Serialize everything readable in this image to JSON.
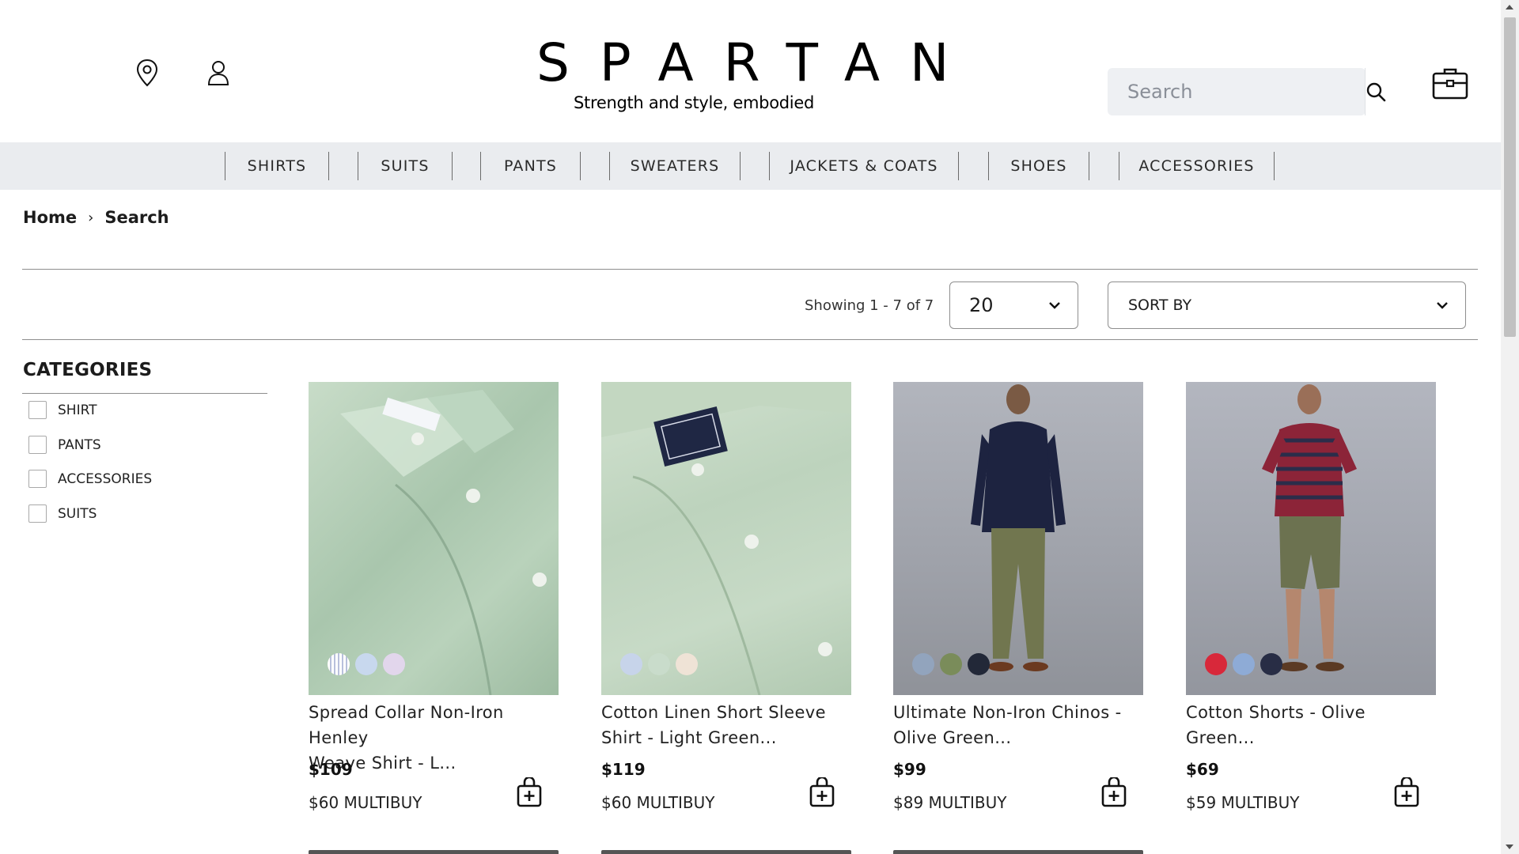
{
  "header": {
    "brand_name": "SPARTAN",
    "tagline": "Strength and style, embodied",
    "search_placeholder": "Search"
  },
  "nav": {
    "items": [
      "SHIRTS",
      "SUITS",
      "PANTS",
      "SWEATERS",
      "JACKETS & COATS",
      "SHOES",
      "ACCESSORIES"
    ]
  },
  "breadcrumb": {
    "home": "Home",
    "separator": "›",
    "current": "Search"
  },
  "toolbar": {
    "showing": "Showing 1 - 7 of 7",
    "per_page": "20",
    "sort_label": "SORT BY"
  },
  "sidebar": {
    "title": "CATEGORIES",
    "categories": [
      "SHIRT",
      "PANTS",
      "ACCESSORIES",
      "SUITS"
    ]
  },
  "products": [
    {
      "name_line1": "Spread Collar Non-Iron Henley",
      "name_line2": "Weave Shirt - L...",
      "price": "$109",
      "multibuy": "$60 MULTIBUY",
      "swatches": [
        "#d6dbea",
        "#c8d8ee",
        "#e2d6ec"
      ]
    },
    {
      "name_line1": "Cotton Linen Short Sleeve",
      "name_line2": "Shirt - Light Green...",
      "price": "$119",
      "multibuy": "$60 MULTIBUY",
      "swatches": [
        "#c7d4ea",
        "#c9dccb",
        "#efe3d6"
      ]
    },
    {
      "name_line1": "Ultimate Non-Iron Chinos -",
      "name_line2": "Olive Green...",
      "price": "$99",
      "multibuy": "$89 MULTIBUY",
      "swatches": [
        "#92a4bd",
        "#7a8c5a",
        "#222838"
      ]
    },
    {
      "name_line1": "Cotton Shorts - Olive Green...",
      "name_line2": "",
      "price": "$69",
      "multibuy": "$59 MULTIBUY",
      "swatches": [
        "#d8283a",
        "#8eabd6",
        "#282d45"
      ]
    }
  ],
  "colors": {
    "nav_bg": "#eaecef",
    "search_bg": "#eef0f3",
    "rule": "#8e8e8e"
  },
  "icons": [
    "location-pin-icon",
    "user-icon",
    "search-icon",
    "briefcase-cart-icon",
    "chevron-down-icon",
    "bag-add-icon"
  ]
}
